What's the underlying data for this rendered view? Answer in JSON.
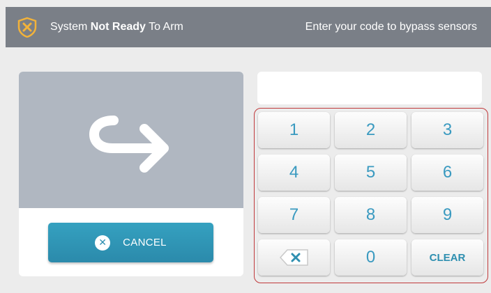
{
  "header": {
    "status_prefix": "System",
    "status_bold": "Not Ready",
    "status_suffix": "To Arm",
    "instruction": "Enter your code to bypass sensors",
    "status_icon": "shield-x-icon"
  },
  "left_panel": {
    "image_icon": "curved-arrow-icon",
    "cancel_label": "CANCEL",
    "cancel_icon": "close-circle-icon"
  },
  "code_input": {
    "value": "",
    "placeholder": ""
  },
  "keypad": {
    "keys": [
      "1",
      "2",
      "3",
      "4",
      "5",
      "6",
      "7",
      "8",
      "9",
      "0"
    ],
    "clear_label": "CLEAR",
    "backspace_icon": "backspace-icon"
  },
  "colors": {
    "header_bg": "#7a7f87",
    "accent": "#2e8fb0",
    "shield": "#f2b23a",
    "keypad_border": "#c0393b"
  }
}
